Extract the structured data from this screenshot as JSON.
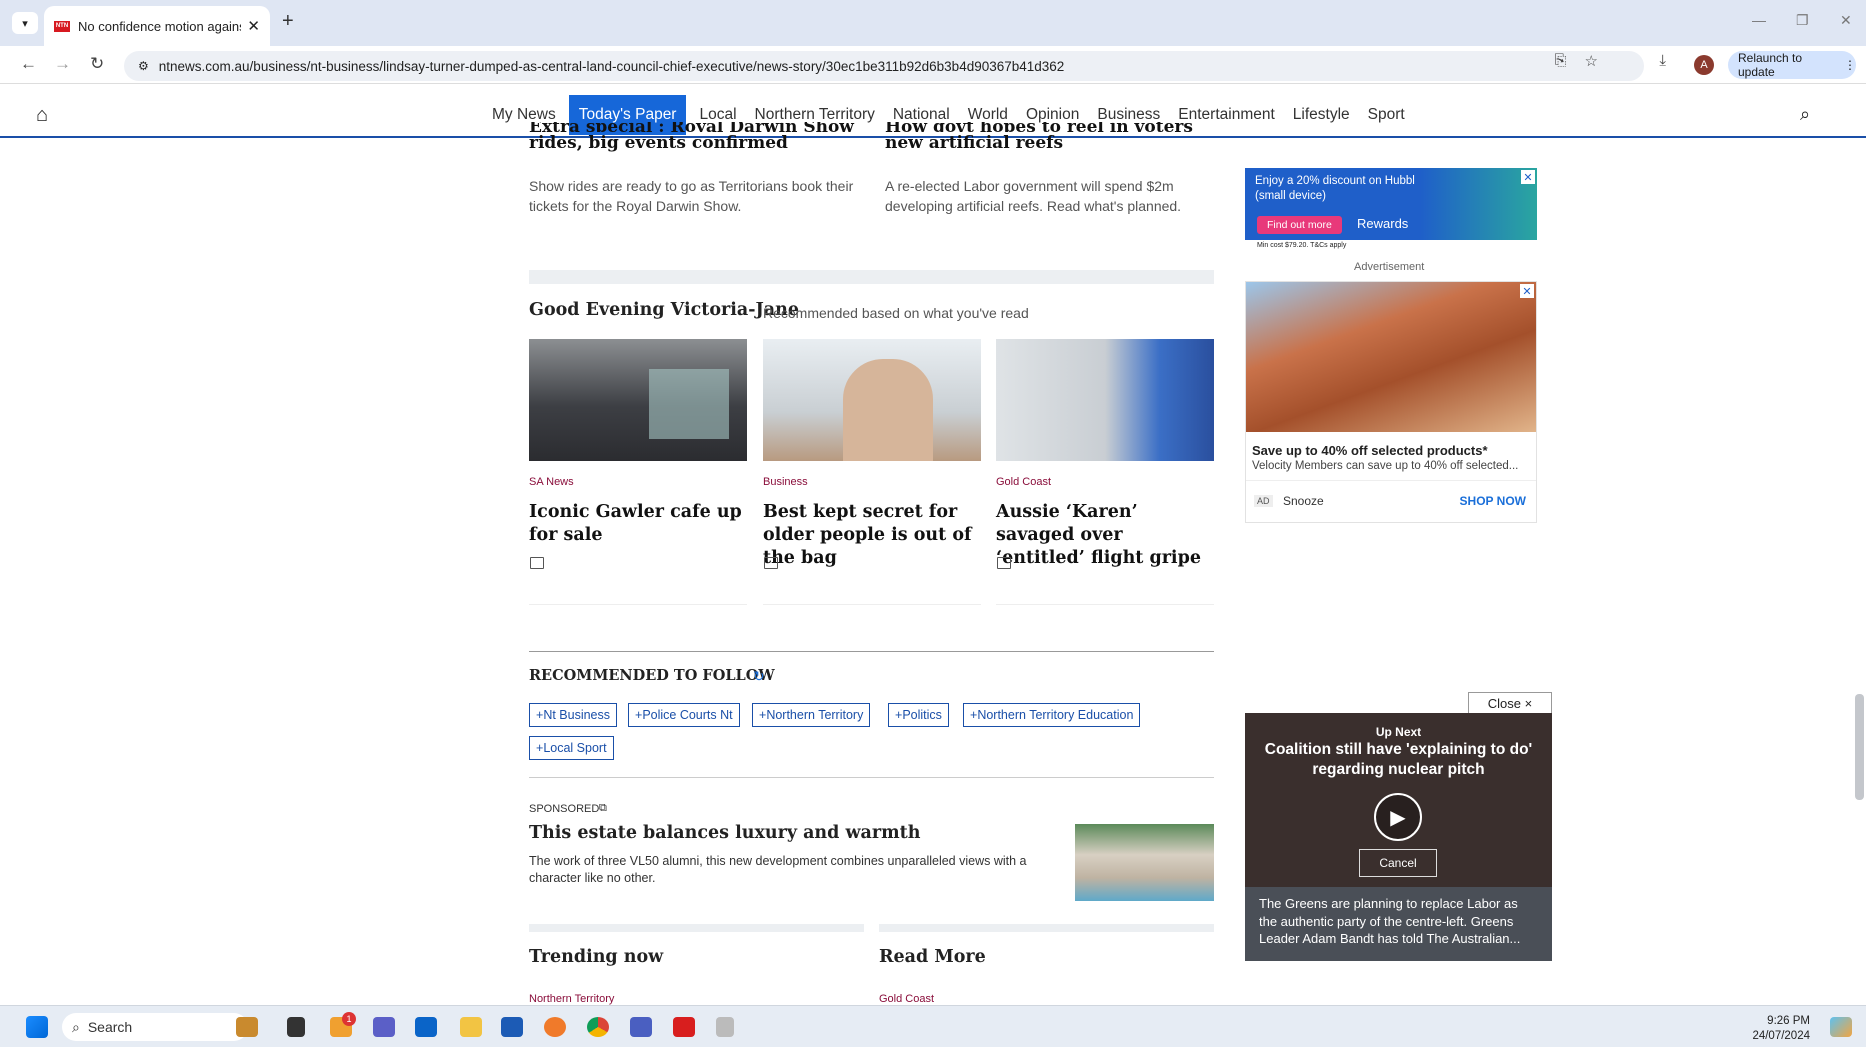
{
  "browser": {
    "tab_title": "No confidence motion against",
    "url": "ntnews.com.au/business/nt-business/lindsay-turner-dumped-as-central-land-council-chief-executive/news-story/30ec1be311b92d6b3b4d90367b41d362",
    "relaunch_label": "Relaunch to update",
    "avatar_letter": "A",
    "favicon_text": "NTN"
  },
  "site_nav": {
    "items": [
      "My News",
      "Today's Paper",
      "Local",
      "Northern Territory",
      "National",
      "World",
      "Opinion",
      "Business",
      "Entertainment",
      "Lifestyle",
      "Sport"
    ],
    "active": "Today's Paper"
  },
  "top_stories": [
    {
      "title_line1": "Extra special : Royal Darwin Show",
      "title_line2": "rides, big events confirmed",
      "desc": "Show rides are ready to go as Territorians book their tickets for the Royal Darwin Show."
    },
    {
      "title_line1": "How govt hopes to reel in voters with",
      "title_line2": "new artificial reefs",
      "desc": "A re-elected Labor government will spend $2m developing artificial reefs. Read what's planned."
    }
  ],
  "recommended": {
    "greeting": "Good Evening Victoria-Jane",
    "subtitle": "Recommended based on what you've read",
    "cards": [
      {
        "category": "SA News",
        "title": "Iconic Gawler cafe up for sale"
      },
      {
        "category": "Business",
        "title": "Best kept secret for older people is out of the bag"
      },
      {
        "category": "Gold Coast",
        "title": "Aussie ‘Karen’ savaged over ‘entitled’ flight gripe"
      }
    ]
  },
  "follow": {
    "heading": "RECOMMENDED TO FOLLOW",
    "chips": [
      "Nt Business",
      "Police Courts Nt",
      "Northern Territory",
      "Politics",
      "Northern Territory Education",
      "Local Sport"
    ]
  },
  "sponsored": {
    "label": "SPONSORED",
    "title": "This estate balances luxury and warmth",
    "desc": "The work of three VL50 alumni, this new development combines unparalleled views with a character like no other."
  },
  "bottom": {
    "trending": "Trending now",
    "trending_cat": "Northern Territory",
    "read_more": "Read More",
    "read_more_cat": "Gold Coast"
  },
  "ads": {
    "hubbl_text": "Enjoy a 20% discount on Hubbl (small device)",
    "hubbl_button": "Find out more",
    "hubbl_rewards": "Rewards",
    "hubbl_fine": "Min cost $79.20. T&Cs apply",
    "ad_label": "Advertisement",
    "velocity_title": "Save up to 40% off selected products*",
    "velocity_desc": "Velocity Members can save up to 40% off selected...",
    "ad_badge": "AD",
    "advertiser": "Snooze",
    "cta": "SHOP NOW"
  },
  "video": {
    "close_label": "Close ×",
    "up_next": "Up Next",
    "title": "Coalition still have 'explaining to do' regarding nuclear pitch",
    "cancel": "Cancel",
    "summary": "The Greens are planning to replace Labor as the authentic party of the centre-left. Greens Leader Adam Bandt has told The Australian..."
  },
  "taskbar": {
    "search": "Search",
    "time": "9:26 PM",
    "date": "24/07/2024",
    "badge": "1"
  }
}
